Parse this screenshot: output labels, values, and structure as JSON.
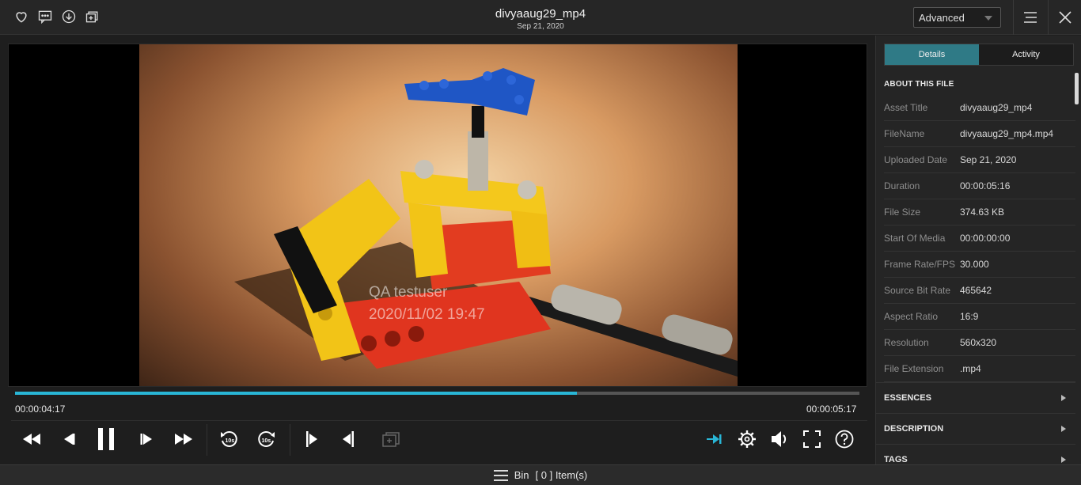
{
  "header": {
    "title": "divyaaug29_mp4",
    "date": "Sep 21, 2020",
    "mode": "Advanced",
    "icons": [
      "heart-icon",
      "comment-icon",
      "download-icon",
      "add-to-bin-icon",
      "menu-icon",
      "close-icon"
    ]
  },
  "player": {
    "watermark_line1": "QA testuser",
    "watermark_line2": "2020/11/02 19:47",
    "current_time": "00:00:04:17",
    "duration": "00:00:05:17",
    "progress_fraction": 0.665,
    "accent_color": "#29b6d6"
  },
  "sidebar": {
    "tabs": [
      "Details",
      "Activity"
    ],
    "active_tab": "Details",
    "section_title": "ABOUT THIS FILE",
    "rows": [
      {
        "k": "Asset Title",
        "v": "divyaaug29_mp4"
      },
      {
        "k": "FileName",
        "v": "divyaaug29_mp4.mp4"
      },
      {
        "k": "Uploaded Date",
        "v": "Sep 21, 2020"
      },
      {
        "k": "Duration",
        "v": "00:00:05:16"
      },
      {
        "k": "File Size",
        "v": "374.63 KB"
      },
      {
        "k": "Start Of Media",
        "v": "00:00:00:00"
      },
      {
        "k": "Frame Rate/FPS",
        "v": "30.000"
      },
      {
        "k": "Source Bit Rate",
        "v": "465642"
      },
      {
        "k": "Aspect Ratio",
        "v": "16:9"
      },
      {
        "k": "Resolution",
        "v": "560x320"
      },
      {
        "k": "File Extension",
        "v": ".mp4"
      }
    ],
    "accordions": [
      "ESSENCES",
      "DESCRIPTION",
      "TAGS"
    ]
  },
  "footer": {
    "bin_label": "Bin",
    "bin_count": "[ 0 ] Item(s)"
  }
}
